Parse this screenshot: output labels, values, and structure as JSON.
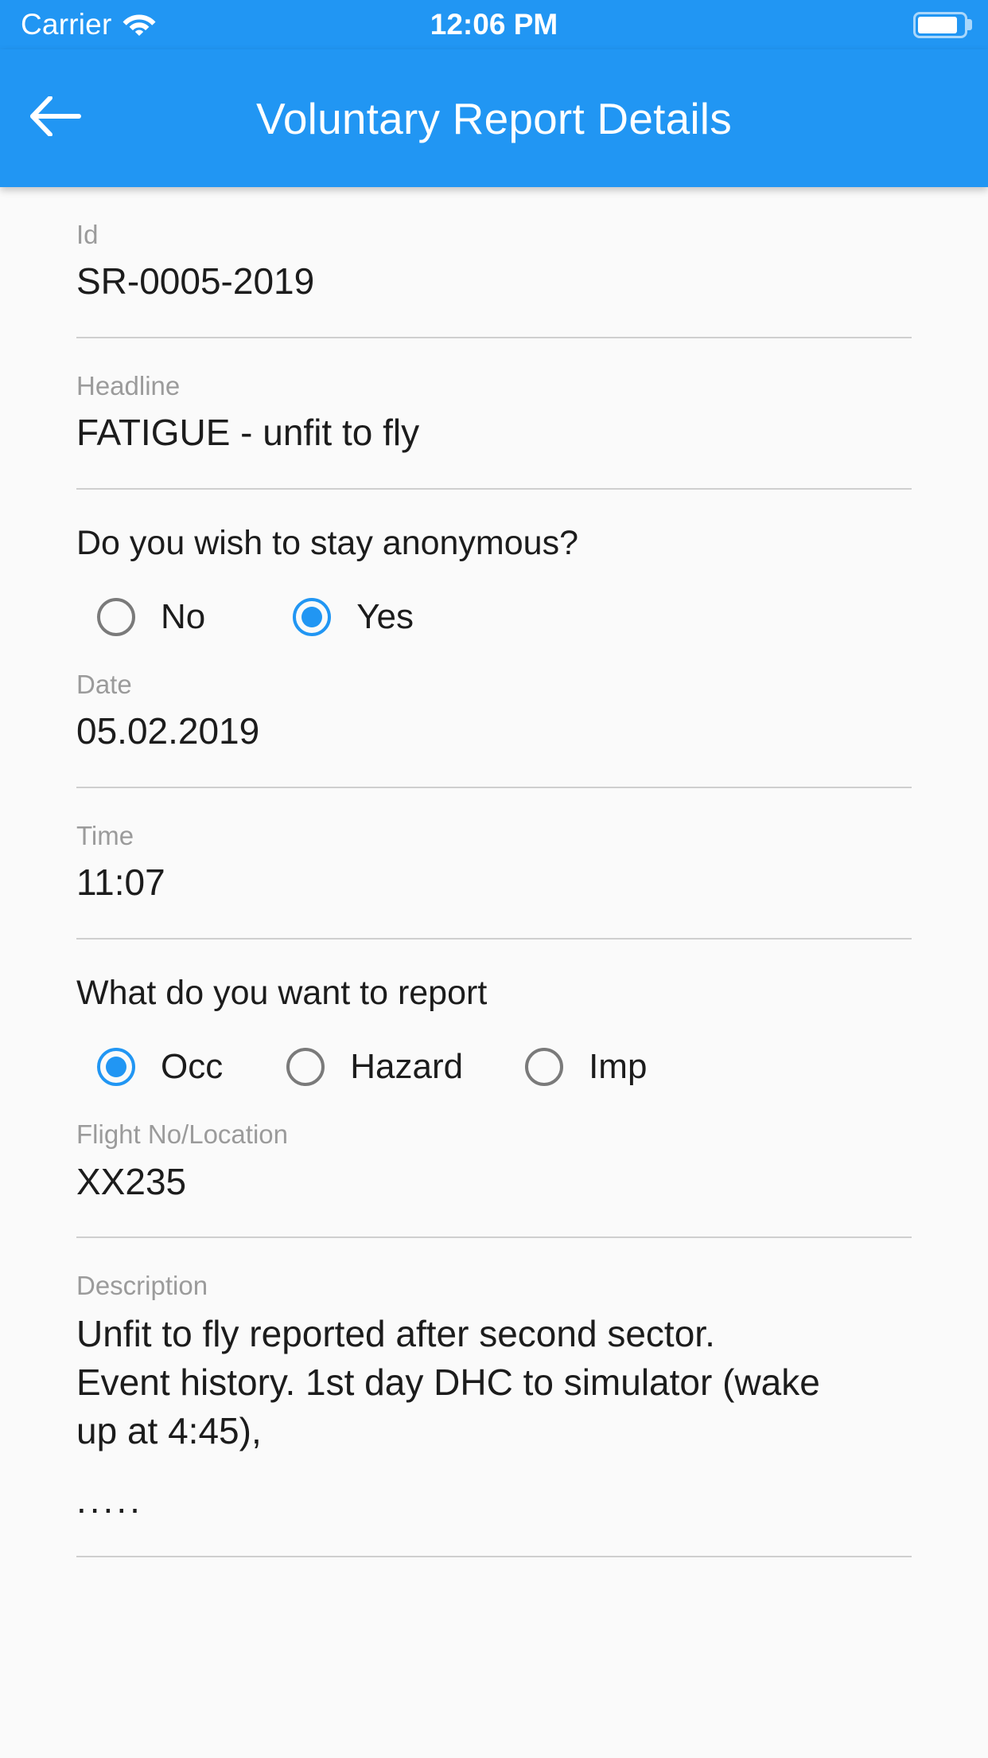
{
  "status_bar": {
    "carrier": "Carrier",
    "time": "12:06 PM",
    "wifi_icon": "wifi-icon",
    "battery_icon": "battery-full-icon"
  },
  "app_bar": {
    "back_icon": "arrow-left-icon",
    "title": "Voluntary Report Details"
  },
  "colors": {
    "accent": "#2196F3",
    "background": "#FAFAFA",
    "label": "#9B9B9B",
    "value": "#1C1C1C",
    "divider": "#CFCFCF",
    "radio_unselected": "#7A7A7A"
  },
  "form": {
    "id": {
      "label": "Id",
      "value": "SR-0005-2019"
    },
    "headline": {
      "label": "Headline",
      "value": "FATIGUE - unfit to fly"
    },
    "anonymous": {
      "question": "Do you wish to stay anonymous?",
      "options": [
        {
          "label": "No",
          "selected": false
        },
        {
          "label": "Yes",
          "selected": true
        }
      ]
    },
    "date": {
      "label": "Date",
      "value": "05.02.2019"
    },
    "time": {
      "label": "Time",
      "value": "11:07"
    },
    "report_type": {
      "question": "What do you want to report",
      "options": [
        {
          "label": "Occ",
          "selected": true
        },
        {
          "label": "Hazard",
          "selected": false
        },
        {
          "label": "Imp",
          "selected": false
        }
      ]
    },
    "flight": {
      "label": "Flight No/Location",
      "value": "XX235"
    },
    "description": {
      "label": "Description",
      "value": "Unfit to fly reported after second sector.\nEvent history. 1st day DHC to simulator (wake\nup at 4:45),",
      "more": "....."
    }
  }
}
